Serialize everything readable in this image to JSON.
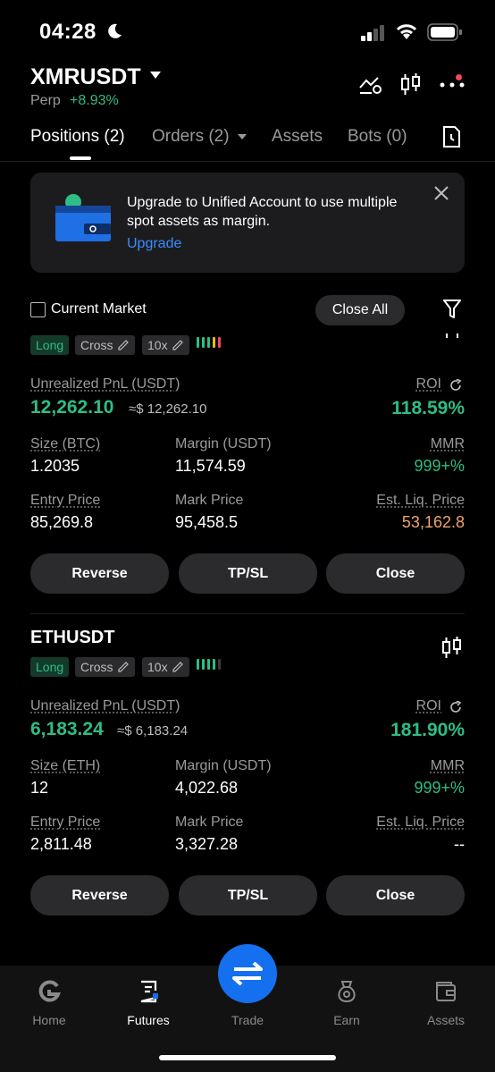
{
  "status": {
    "time": "04:28"
  },
  "header": {
    "pair": "XMRUSDT",
    "type": "Perp",
    "change": "+8.93%"
  },
  "tabs": [
    {
      "label": "Positions (2)"
    },
    {
      "label": "Orders (2)"
    },
    {
      "label": "Assets"
    },
    {
      "label": "Bots (0)"
    }
  ],
  "banner": {
    "text": "Upgrade to Unified Account to use multiple spot assets as margin.",
    "link": "Upgrade"
  },
  "filter": {
    "current_market": "Current Market",
    "close_all": "Close All"
  },
  "labels": {
    "unrealized": "Unrealized PnL (USDT)",
    "roi": "ROI",
    "margin": "Margin (USDT)",
    "mmr": "MMR",
    "entry": "Entry Price",
    "mark": "Mark Price",
    "liq": "Est. Liq. Price",
    "reverse": "Reverse",
    "tpsl": "TP/SL",
    "close": "Close"
  },
  "positions": [
    {
      "symbol": "",
      "side": "Long",
      "mode": "Cross",
      "leverage": "10x",
      "pnl": "12,262.10",
      "pnl_approx": "≈$ 12,262.10",
      "roi": "118.59%",
      "size_label": "Size (BTC)",
      "size": "1.2035",
      "margin": "11,574.59",
      "mmr": "999+%",
      "entry": "85,269.8",
      "mark": "95,458.5",
      "liq": "53,162.8"
    },
    {
      "symbol": "ETHUSDT",
      "side": "Long",
      "mode": "Cross",
      "leverage": "10x",
      "pnl": "6,183.24",
      "pnl_approx": "≈$ 6,183.24",
      "roi": "181.90%",
      "size_label": "Size (ETH)",
      "size": "12",
      "margin": "4,022.68",
      "mmr": "999+%",
      "entry": "2,811.48",
      "mark": "3,327.28",
      "liq": "--"
    }
  ],
  "nav": [
    {
      "label": "Home",
      "icon": "home-icon"
    },
    {
      "label": "Futures",
      "icon": "futures-icon"
    },
    {
      "label": "Trade",
      "icon": "swap-icon"
    },
    {
      "label": "Earn",
      "icon": "earn-icon"
    },
    {
      "label": "Assets",
      "icon": "wallet-icon"
    }
  ],
  "colors": {
    "green": "#2ebd85",
    "red": "#f6465d",
    "blue": "#1570ef",
    "link": "#3b8cff",
    "orange": "#f0a36b"
  }
}
